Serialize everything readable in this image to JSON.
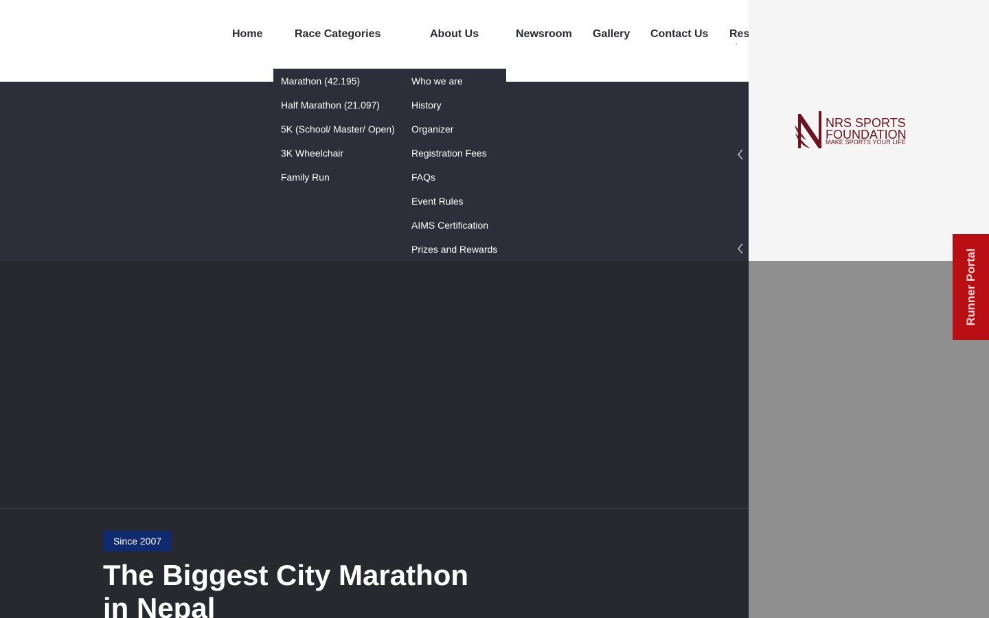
{
  "nav": {
    "items": [
      {
        "label": "Home"
      },
      {
        "label": "Race Categories"
      },
      {
        "label": "About Us"
      },
      {
        "label": "Newsroom"
      },
      {
        "label": "Gallery"
      },
      {
        "label": "Contact Us"
      },
      {
        "label": "Results"
      }
    ]
  },
  "race_categories_menu": {
    "items": [
      "Marathon (42.195)",
      "Half Marathon (21.097)",
      "5K (School/ Master/ Open)",
      "3K Wheelchair",
      "Family Run"
    ]
  },
  "about_us_menu": {
    "items": [
      "Who we are",
      "History",
      "Organizer",
      "Registration Fees",
      "FAQs",
      "Event Rules",
      "AIMS Certification",
      "Prizes and Rewards"
    ]
  },
  "logo": {
    "line1": "NRS SPORTS",
    "line2": "FOUNDATION",
    "tagline": "MAKE SPORTS YOUR LIFE",
    "color": "#6b1420"
  },
  "runner_portal": {
    "label": "Runner Portal",
    "color": "#b90f14"
  },
  "hero": {
    "badge": "Since 2007",
    "title": "The Biggest City Marathon in Nepal",
    "badge_color": "#0f2a6f"
  },
  "icons": {
    "slider_prev": "chevron-left-icon",
    "slider_prev_secondary": "chevron-left-icon"
  }
}
